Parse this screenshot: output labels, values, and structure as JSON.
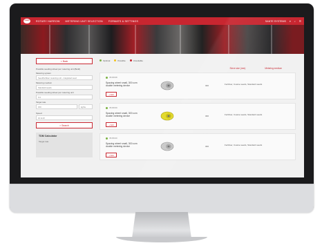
{
  "topbar": {
    "logo": "LEMKEN",
    "nav": [
      "ROTARY HARROW",
      "METERING UNIT SELECTION",
      "FORMATS & SETTINGS"
    ],
    "user": "SANTE SYSTEMS",
    "brand_color": "#c82630"
  },
  "sidebar": {
    "back_label": "< Back",
    "intro": "Possible seeding wheel per metering unit (Build)",
    "fields": [
      {
        "label": "Metering system",
        "value": "Seed/fertiliser metering unit - integrated seed"
      },
      {
        "label": "Metering medium",
        "value": "Standard seeds"
      },
      {
        "label": "Possible seeding wheel per metering unit",
        "value": "5.5"
      },
      {
        "label": "Target rate",
        "value": "150",
        "unit": "kg/ha"
      },
      {
        "label": "Speed",
        "value": "10 km/h"
      }
    ],
    "search_label": "> Search",
    "tdm": {
      "title": "TDM Calculator",
      "subtitle": "Target rate"
    }
  },
  "legend": [
    {
      "label": "Optimal",
      "color": "#7cb342"
    },
    {
      "label": "Possible",
      "color": "#f2c21b"
    },
    {
      "label": "Unsuitable",
      "color": "#c82630"
    }
  ],
  "columns": {
    "size": "Sieve size (mm)",
    "medium": "Metering medium"
  },
  "results": [
    {
      "number": "3515038",
      "status_color": "#7cb342",
      "description": "Spacing wheel small, 300 ccm double metering device",
      "add": "+ Add",
      "size": "300",
      "medium": "Fertiliser, Coarse seeds, Standard seeds",
      "part_color": "#c8c8c8"
    },
    {
      "number": "3515039",
      "status_color": "#7cb342",
      "description": "Spacing wheel small, 300 ccm double metering device",
      "add": "+ Add",
      "size": "300",
      "medium": "Fertiliser, Coarse seeds, Standard seeds",
      "part_color": "#e3da2e"
    },
    {
      "number": "3515040",
      "status_color": "#7cb342",
      "description": "Spacing wheel small, 300 ccm double metering device",
      "add": "+ Add",
      "size": "300",
      "medium": "Fertiliser, Coarse seeds, Standard seeds",
      "part_color": "#c8c8c8"
    }
  ]
}
